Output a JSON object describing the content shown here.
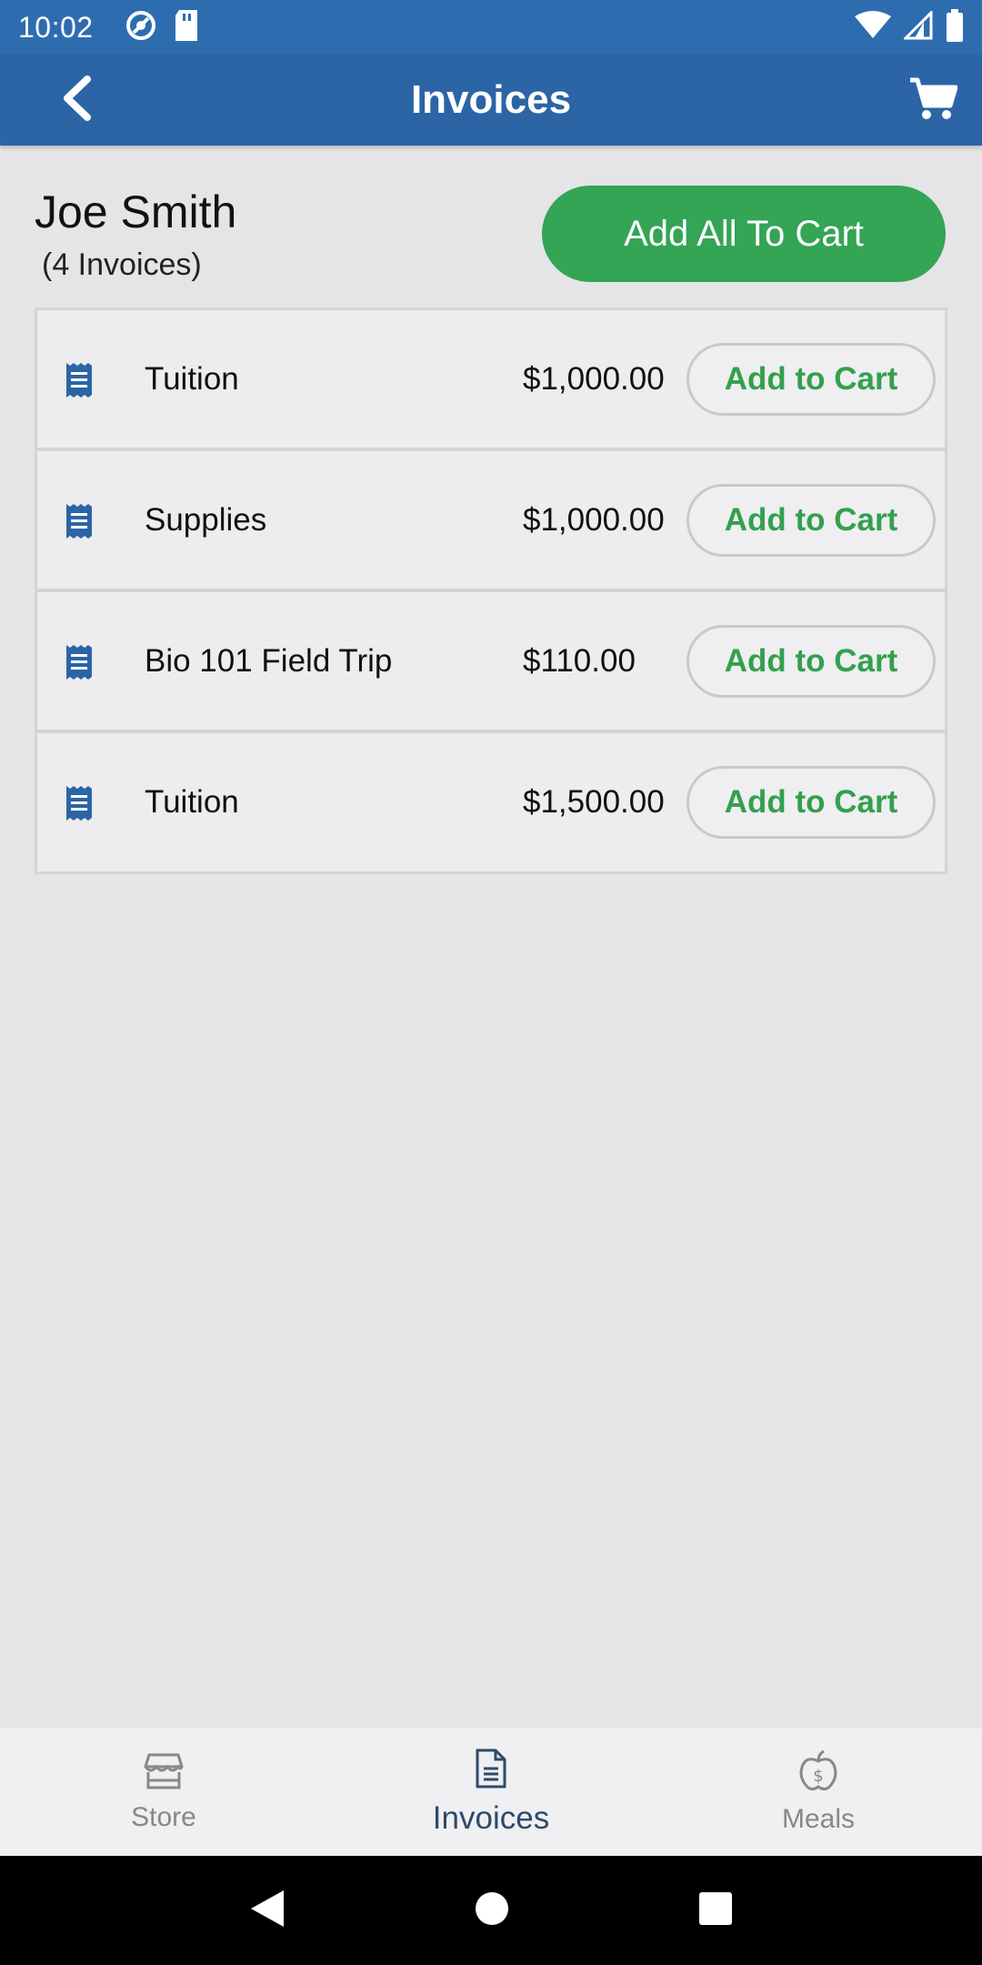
{
  "status_bar": {
    "time": "10:02",
    "left_icons": [
      "sync-icon",
      "sd-card-icon"
    ],
    "right_icons": [
      "wifi-icon",
      "signal-icon",
      "battery-icon"
    ]
  },
  "app_bar": {
    "title": "Invoices",
    "back_icon": "chevron-left-icon",
    "cart_icon": "cart-icon"
  },
  "customer": {
    "name": "Joe Smith",
    "invoice_count": "(4 Invoices)",
    "add_all_label": "Add All To Cart"
  },
  "invoices": [
    {
      "name": "Tuition",
      "amount": "$1,000.00",
      "action": "Add to Cart"
    },
    {
      "name": "Supplies",
      "amount": "$1,000.00",
      "action": "Add to Cart"
    },
    {
      "name": "Bio 101 Field Trip",
      "amount": "$110.00",
      "action": "Add to Cart"
    },
    {
      "name": "Tuition",
      "amount": "$1,500.00",
      "action": "Add to Cart"
    }
  ],
  "bottom_nav": {
    "items": [
      {
        "label": "Store",
        "icon": "store-icon"
      },
      {
        "label": "Invoices",
        "icon": "document-icon",
        "active": true
      },
      {
        "label": "Meals",
        "icon": "apple-dollar-icon"
      }
    ]
  },
  "colors": {
    "primary": "#2b65a6",
    "accent_green": "#34a455",
    "background": "#e5e4e6"
  }
}
